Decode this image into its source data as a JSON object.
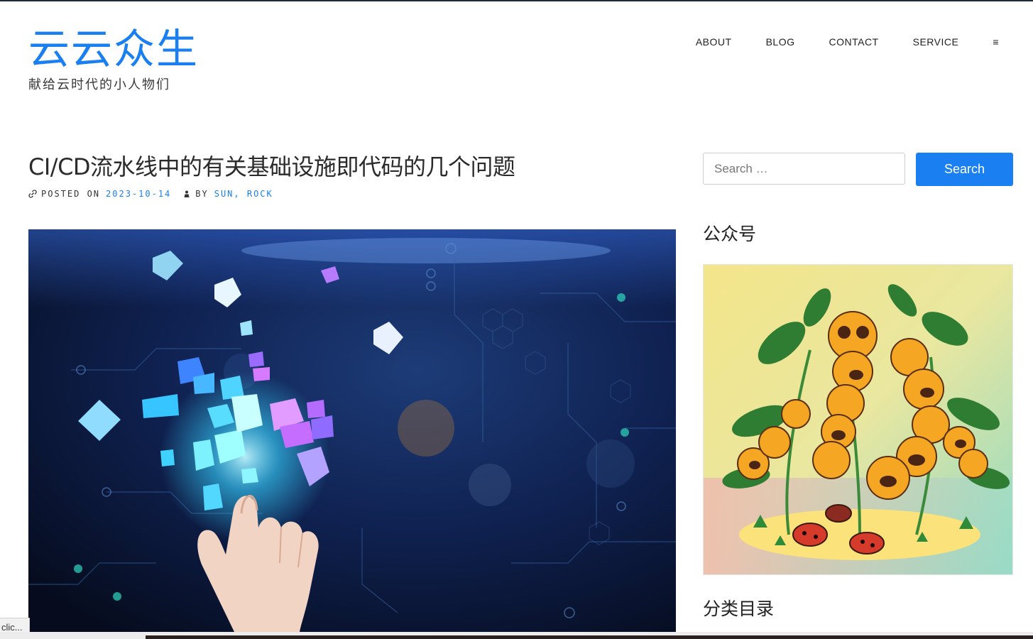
{
  "site": {
    "title": "云云众生",
    "tagline": "献给云时代的小人物们"
  },
  "nav": {
    "items": [
      "ABOUT",
      "BLOG",
      "CONTACT",
      "SERVICE"
    ],
    "menu_toggle": "≡"
  },
  "post": {
    "title": "CI/CD流水线中的有关基础设施即代码的几个问题",
    "posted_on_label": "POSTED ON",
    "date": "2023-10-14",
    "by_label": "BY",
    "authors": "SUN, ROCK"
  },
  "sidebar": {
    "search": {
      "placeholder": "Search …",
      "button_label": "Search"
    },
    "widget_wechat_title": "公众号",
    "widget_categories_title": "分类目录"
  },
  "status_tip": "clic...",
  "colors": {
    "accent": "#1a7ff0",
    "text": "#2b2b2b"
  }
}
